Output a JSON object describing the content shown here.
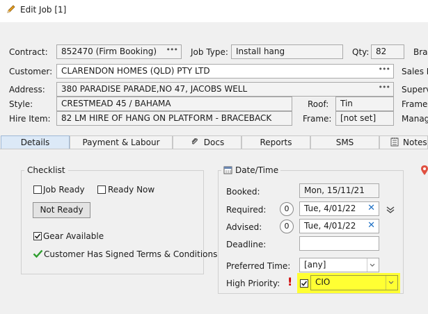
{
  "window": {
    "title": "Edit Job [1]"
  },
  "header": {
    "contract_label": "Contract:",
    "contract_value": "852470 (Firm Booking)",
    "jobtype_label": "Job Type:",
    "jobtype_value": "Install hang",
    "qty_label": "Qty:",
    "qty_value": "82",
    "bran_label": "Bran",
    "customer_label": "Customer:",
    "customer_value": "CLARENDON HOMES (QLD) PTY LTD",
    "salesrep_label": "Sales Re",
    "address_label": "Address:",
    "address_value": "380 PARADISE PARADE,NO 47, JACOBS WELL",
    "supervisor_label": "Supervi",
    "style_label": "Style:",
    "style_value": "CRESTMEAD 45 / BAHAMA",
    "roof_label": "Roof:",
    "roof_value": "Tin",
    "framer_label": "Framer",
    "hireitem_label": "Hire Item:",
    "hireitem_value": "82 LM HIRE OF HANG ON PLATFORM - BRACEBACK",
    "frame_label": "Frame:",
    "frame_value": "[not set]",
    "manager_label": "Manag",
    "dots": "•••"
  },
  "tabs": [
    {
      "label": "Details"
    },
    {
      "label": "Payment & Labour"
    },
    {
      "label": "Docs"
    },
    {
      "label": "Reports"
    },
    {
      "label": "SMS"
    },
    {
      "label": "Notes"
    }
  ],
  "checklist": {
    "title": "Checklist",
    "job_ready": "Job Ready",
    "ready_now": "Ready Now",
    "not_ready_button": "Not Ready",
    "gear_available": "Gear Available",
    "customer_signed": "Customer Has Signed Terms & Conditions"
  },
  "datetime": {
    "title": "Date/Time",
    "booked_label": "Booked:",
    "booked_value": "Mon, 15/11/21",
    "required_label": "Required:",
    "required_value": "Tue, 4/01/22",
    "advised_label": "Advised:",
    "advised_value": "Tue, 4/01/22",
    "deadline_label": "Deadline:",
    "deadline_value": "",
    "circle_zero": "0",
    "preferred_label": "Preferred Time:",
    "preferred_value": "[any]",
    "priority_label": "High Priority:",
    "priority_value": "CIO",
    "exclaim": "!"
  },
  "colors": {
    "highlight": "#ffff33",
    "tab_active": "#dce9f7",
    "check_green": "#2e9e2e",
    "exclaim_red": "#d00000",
    "x_blue": "#1d6fc4"
  }
}
